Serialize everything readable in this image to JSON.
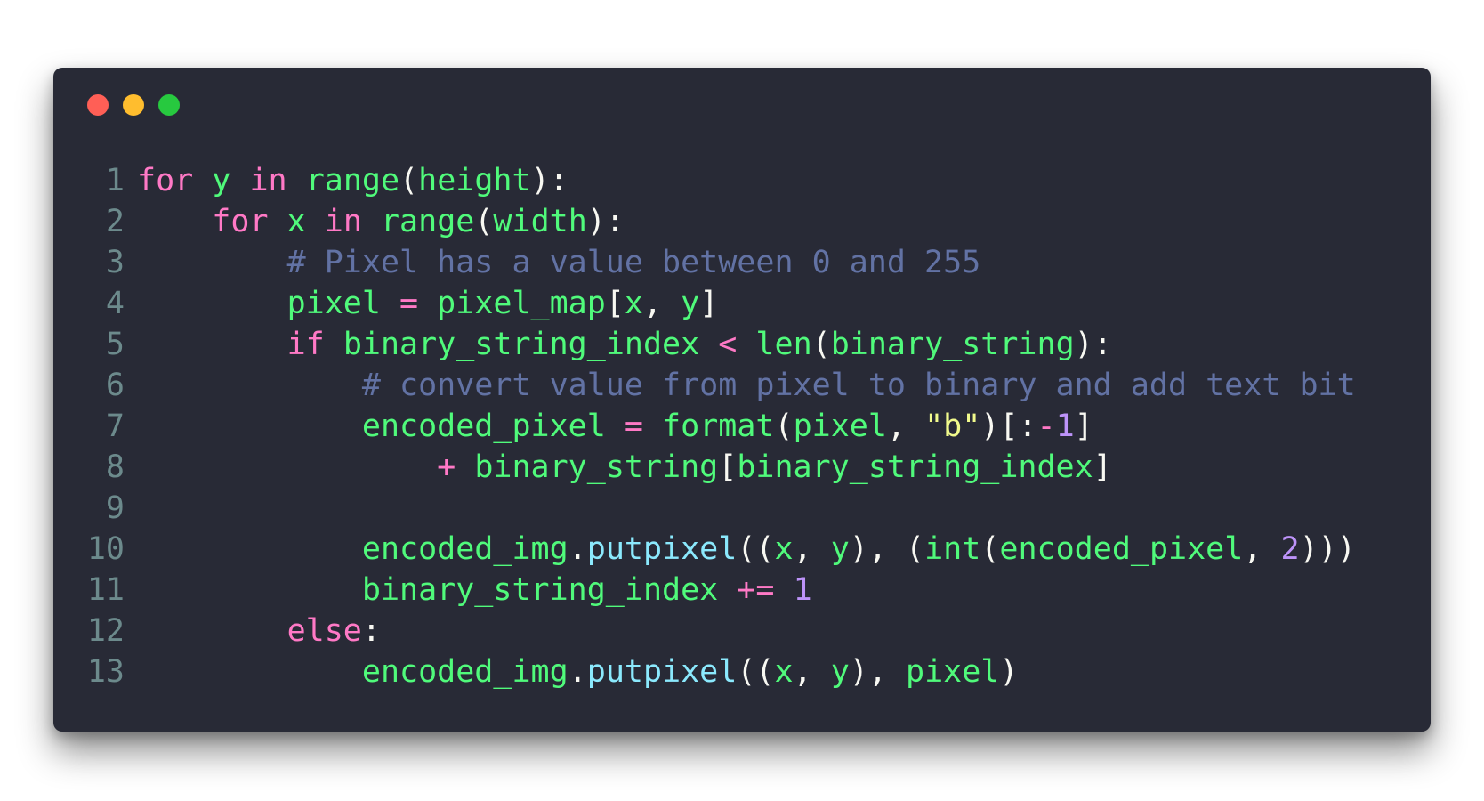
{
  "window": {
    "controls": [
      {
        "name": "close",
        "color": "#ff5f56"
      },
      {
        "name": "minimize",
        "color": "#ffbd2e"
      },
      {
        "name": "maximize",
        "color": "#27c93f"
      }
    ]
  },
  "theme": {
    "background": "#282a36",
    "keyword": "#ff79c6",
    "name": "#50fa7b",
    "comment": "#6272a4",
    "string": "#f1fa8c",
    "number": "#bd93f9",
    "method": "#8be9fd",
    "line_number": "#6c8a8c"
  },
  "code": {
    "lines": [
      {
        "n": "1",
        "tokens": [
          [
            "kw",
            "for"
          ],
          [
            "pn",
            " "
          ],
          [
            "nm",
            "y"
          ],
          [
            "pn",
            " "
          ],
          [
            "kw",
            "in"
          ],
          [
            "pn",
            " "
          ],
          [
            "nm",
            "range"
          ],
          [
            "pn",
            "("
          ],
          [
            "nm",
            "height"
          ],
          [
            "pn",
            "):"
          ]
        ]
      },
      {
        "n": "2",
        "tokens": [
          [
            "pn",
            "    "
          ],
          [
            "kw",
            "for"
          ],
          [
            "pn",
            " "
          ],
          [
            "nm",
            "x"
          ],
          [
            "pn",
            " "
          ],
          [
            "kw",
            "in"
          ],
          [
            "pn",
            " "
          ],
          [
            "nm",
            "range"
          ],
          [
            "pn",
            "("
          ],
          [
            "nm",
            "width"
          ],
          [
            "pn",
            "):"
          ]
        ]
      },
      {
        "n": "3",
        "tokens": [
          [
            "pn",
            "        "
          ],
          [
            "cm",
            "# Pixel has a value between 0 and 255"
          ]
        ]
      },
      {
        "n": "4",
        "tokens": [
          [
            "pn",
            "        "
          ],
          [
            "nm",
            "pixel"
          ],
          [
            "pn",
            " "
          ],
          [
            "kw",
            "="
          ],
          [
            "pn",
            " "
          ],
          [
            "nm",
            "pixel_map"
          ],
          [
            "pn",
            "["
          ],
          [
            "nm",
            "x"
          ],
          [
            "pn",
            ", "
          ],
          [
            "nm",
            "y"
          ],
          [
            "pn",
            "]"
          ]
        ]
      },
      {
        "n": "5",
        "tokens": [
          [
            "pn",
            "        "
          ],
          [
            "kw",
            "if"
          ],
          [
            "pn",
            " "
          ],
          [
            "nm",
            "binary_string_index"
          ],
          [
            "pn",
            " "
          ],
          [
            "kw",
            "<"
          ],
          [
            "pn",
            " "
          ],
          [
            "nm",
            "len"
          ],
          [
            "pn",
            "("
          ],
          [
            "nm",
            "binary_string"
          ],
          [
            "pn",
            "):"
          ]
        ]
      },
      {
        "n": "6",
        "tokens": [
          [
            "pn",
            "            "
          ],
          [
            "cm",
            "# convert value from pixel to binary and add text bit"
          ]
        ]
      },
      {
        "n": "7",
        "tokens": [
          [
            "pn",
            "            "
          ],
          [
            "nm",
            "encoded_pixel"
          ],
          [
            "pn",
            " "
          ],
          [
            "kw",
            "="
          ],
          [
            "pn",
            " "
          ],
          [
            "nm",
            "format"
          ],
          [
            "pn",
            "("
          ],
          [
            "nm",
            "pixel"
          ],
          [
            "pn",
            ", "
          ],
          [
            "st",
            "\"b\""
          ],
          [
            "pn",
            ")[:"
          ],
          [
            "kw",
            "-"
          ],
          [
            "num",
            "1"
          ],
          [
            "pn",
            "]"
          ]
        ]
      },
      {
        "n": "8",
        "tokens": [
          [
            "pn",
            "                "
          ],
          [
            "kw",
            "+"
          ],
          [
            "pn",
            " "
          ],
          [
            "nm",
            "binary_string"
          ],
          [
            "pn",
            "["
          ],
          [
            "nm",
            "binary_string_index"
          ],
          [
            "pn",
            "]"
          ]
        ]
      },
      {
        "n": "9",
        "tokens": []
      },
      {
        "n": "10",
        "tokens": [
          [
            "pn",
            "            "
          ],
          [
            "nm",
            "encoded_img"
          ],
          [
            "pn",
            "."
          ],
          [
            "fn",
            "putpixel"
          ],
          [
            "pn",
            "(("
          ],
          [
            "nm",
            "x"
          ],
          [
            "pn",
            ", "
          ],
          [
            "nm",
            "y"
          ],
          [
            "pn",
            "), ("
          ],
          [
            "nm",
            "int"
          ],
          [
            "pn",
            "("
          ],
          [
            "nm",
            "encoded_pixel"
          ],
          [
            "pn",
            ", "
          ],
          [
            "num",
            "2"
          ],
          [
            "pn",
            ")))"
          ]
        ]
      },
      {
        "n": "11",
        "tokens": [
          [
            "pn",
            "            "
          ],
          [
            "nm",
            "binary_string_index"
          ],
          [
            "pn",
            " "
          ],
          [
            "kw",
            "+="
          ],
          [
            "pn",
            " "
          ],
          [
            "num",
            "1"
          ]
        ]
      },
      {
        "n": "12",
        "tokens": [
          [
            "pn",
            "        "
          ],
          [
            "kw",
            "else"
          ],
          [
            "pn",
            ":"
          ]
        ]
      },
      {
        "n": "13",
        "tokens": [
          [
            "pn",
            "            "
          ],
          [
            "nm",
            "encoded_img"
          ],
          [
            "pn",
            "."
          ],
          [
            "fn",
            "putpixel"
          ],
          [
            "pn",
            "(("
          ],
          [
            "nm",
            "x"
          ],
          [
            "pn",
            ", "
          ],
          [
            "nm",
            "y"
          ],
          [
            "pn",
            "), "
          ],
          [
            "nm",
            "pixel"
          ],
          [
            "pn",
            ")"
          ]
        ]
      }
    ]
  }
}
